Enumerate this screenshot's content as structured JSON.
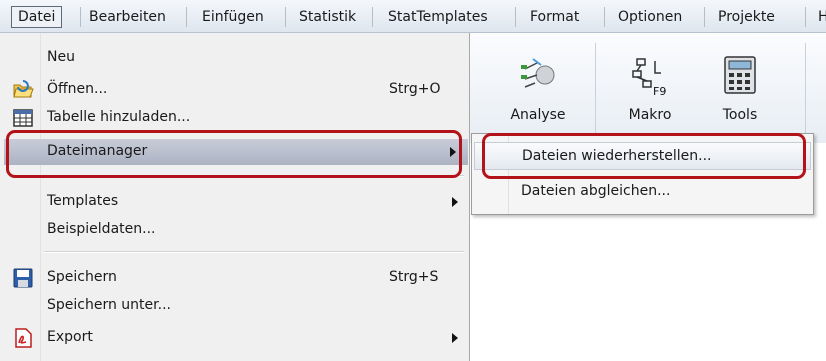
{
  "menubar": {
    "items": [
      {
        "label": "Datei"
      },
      {
        "label": "Bearbeiten"
      },
      {
        "label": "Einfügen"
      },
      {
        "label": "Statistik"
      },
      {
        "label": "StatTemplates"
      },
      {
        "label": "Format"
      },
      {
        "label": "Optionen"
      },
      {
        "label": "Projekte"
      },
      {
        "label": "Hi"
      }
    ]
  },
  "ribbon": {
    "buttons": [
      {
        "label": "Analyse",
        "icon": "analysis-icon"
      },
      {
        "label": "Makro",
        "icon": "macro-icon",
        "badge": "F9"
      },
      {
        "label": "Tools",
        "icon": "calculator-icon"
      }
    ]
  },
  "file_menu": {
    "items": [
      {
        "label": "Neu",
        "shortcut": "",
        "icon": ""
      },
      {
        "label": "Öffnen...",
        "shortcut": "Strg+O",
        "icon": "open-folder-icon"
      },
      {
        "label": "Tabelle hinzuladen...",
        "shortcut": "",
        "icon": "table-icon"
      },
      {
        "label": "Dateimanager",
        "shortcut": "",
        "submenu": true
      },
      {
        "label": "Templates",
        "shortcut": "",
        "submenu": true
      },
      {
        "label": "Beispieldaten...",
        "shortcut": ""
      },
      {
        "label": "Speichern",
        "shortcut": "Strg+S",
        "icon": "floppy-disk-icon"
      },
      {
        "label": "Speichern unter...",
        "shortcut": ""
      },
      {
        "label": "Export",
        "shortcut": "",
        "icon": "pdf-icon",
        "submenu": true
      }
    ]
  },
  "dateimanager_submenu": {
    "items": [
      {
        "label": "Dateien wiederherstellen..."
      },
      {
        "label": "Dateien abgleichen..."
      }
    ]
  },
  "colors": {
    "callout": "#b3121a",
    "highlight": "#b9bdcc"
  }
}
